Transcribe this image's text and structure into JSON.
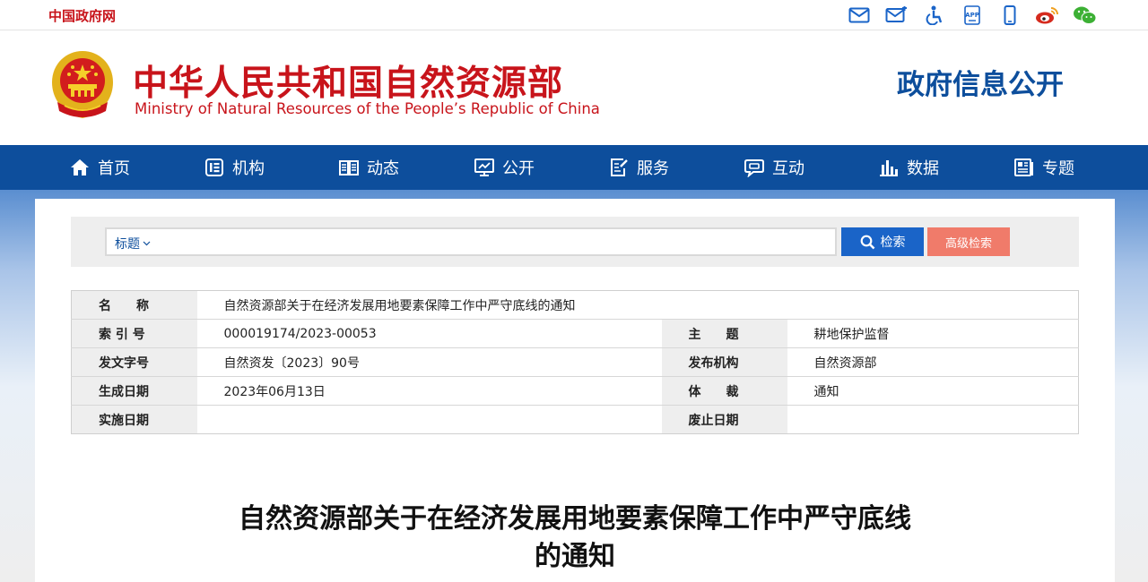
{
  "topbar": {
    "site_link": "中国政府网",
    "icons": [
      "mail-icon",
      "mail-edit-icon",
      "accessibility-icon",
      "app-icon",
      "mobile-icon",
      "weibo-icon",
      "wechat-icon"
    ],
    "app_badge": "APP"
  },
  "header": {
    "title_cn": "中华人民共和国自然资源部",
    "title_en": "Ministry of Natural Resources of the People’s Republic of China",
    "section_title": "政府信息公开"
  },
  "nav": {
    "items": [
      {
        "label": "首页",
        "icon": "home-icon"
      },
      {
        "label": "机构",
        "icon": "org-icon"
      },
      {
        "label": "动态",
        "icon": "book-icon"
      },
      {
        "label": "公开",
        "icon": "monitor-icon"
      },
      {
        "label": "服务",
        "icon": "edit-icon"
      },
      {
        "label": "互动",
        "icon": "chat-icon"
      },
      {
        "label": "数据",
        "icon": "chart-icon"
      },
      {
        "label": "专题",
        "icon": "topic-icon"
      }
    ]
  },
  "search": {
    "scope_label": "标题",
    "query": "",
    "search_button": "检索",
    "advanced_button": "高级检索"
  },
  "info_table": {
    "name_label": "名　　称",
    "name_value": "自然资源部关于在经济发展用地要素保障工作中严守底线的通知",
    "index_label": "索 引 号",
    "index_value": "000019174/2023-00053",
    "topic_label": "主　　题",
    "topic_value": "耕地保护监督",
    "docno_label": "发文字号",
    "docno_value": "自然资发〔2023〕90号",
    "publisher_label": "发布机构",
    "publisher_value": "自然资源部",
    "created_label": "生成日期",
    "created_value": "2023年06月13日",
    "genre_label": "体　　裁",
    "genre_value": "通知",
    "effective_label": "实施日期",
    "effective_value": "",
    "expiry_label": "废止日期",
    "expiry_value": ""
  },
  "article": {
    "title_line1": "自然资源部关于在经济发展用地要素保障工作中严守底线",
    "title_line2": "的通知"
  },
  "colors": {
    "brand_red": "#c8141b",
    "brand_blue": "#0d4e9c",
    "search_blue": "#1a64c8",
    "advanced_coral": "#f07b6a"
  }
}
